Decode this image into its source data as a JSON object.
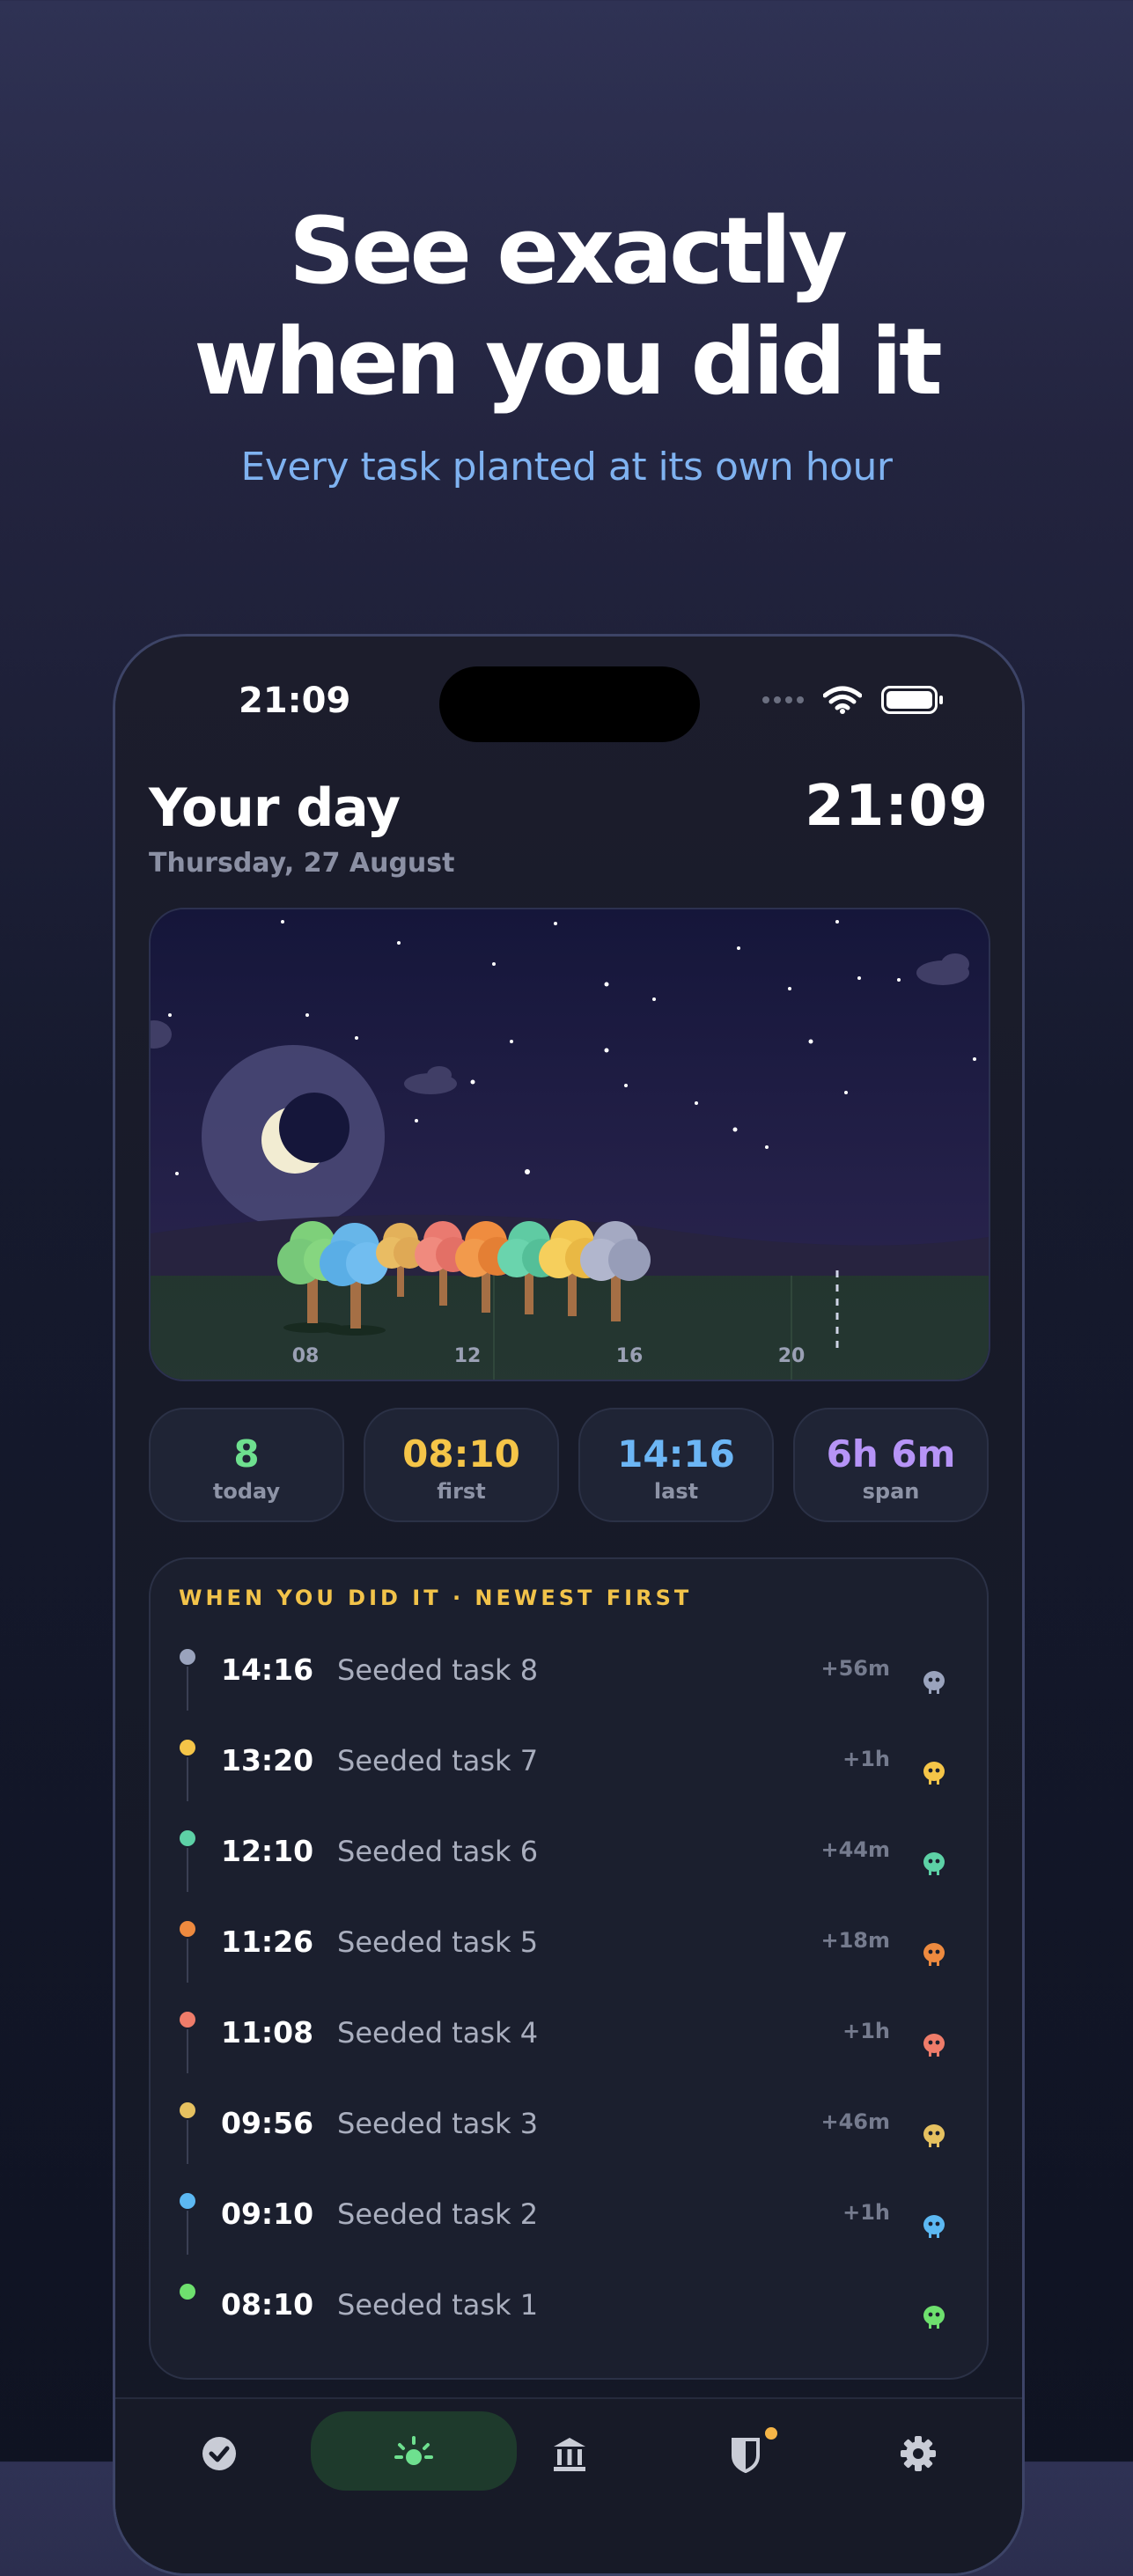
{
  "hero": {
    "line1": "See exactly",
    "line2": "when you did it",
    "subtitle": "Every task planted at its own hour"
  },
  "status_bar": {
    "time": "21:09"
  },
  "header": {
    "title": "Your day",
    "date": "Thursday, 27 August",
    "clock": "21:09"
  },
  "scene": {
    "axis_labels": [
      "08",
      "12",
      "16",
      "20"
    ],
    "sky": "night",
    "colors": {
      "sky_top": "#16163a",
      "sky_bottom": "#2c2550",
      "grass": "#253a30"
    }
  },
  "stats": [
    {
      "value": "8",
      "label": "today",
      "color": "#6ee08f"
    },
    {
      "value": "08:10",
      "label": "first",
      "color": "#f5c548"
    },
    {
      "value": "14:16",
      "label": "last",
      "color": "#6cb6f5"
    },
    {
      "value": "6h 6m",
      "label": "span",
      "color": "#b694f7"
    }
  ],
  "list": {
    "title": "WHEN YOU DID IT · NEWEST FIRST",
    "items": [
      {
        "time": "14:16",
        "label": "Seeded task 8",
        "delta": "+56m",
        "color": "#9aa3bd",
        "icon": "cloud-creature-icon"
      },
      {
        "time": "13:20",
        "label": "Seeded task 7",
        "delta": "+1h",
        "color": "#f5c548",
        "icon": "flag-creature-icon"
      },
      {
        "time": "12:10",
        "label": "Seeded task 6",
        "delta": "+44m",
        "color": "#5dd1a6",
        "icon": "sprout-creature-icon"
      },
      {
        "time": "11:26",
        "label": "Seeded task 5",
        "delta": "+18m",
        "color": "#ee8a3f",
        "icon": "bag-creature-icon"
      },
      {
        "time": "11:08",
        "label": "Seeded task 4",
        "delta": "+1h",
        "color": "#ef7c6a",
        "icon": "check-creature-icon"
      },
      {
        "time": "09:56",
        "label": "Seeded task 3",
        "delta": "+46m",
        "color": "#e6c160",
        "icon": "book-creature-icon"
      },
      {
        "time": "09:10",
        "label": "Seeded task 2",
        "delta": "+1h",
        "color": "#5cb8f2",
        "icon": "drop-creature-icon"
      },
      {
        "time": "08:10",
        "label": "Seeded task 1",
        "delta": "",
        "color": "#6ee06e",
        "icon": "leaf-creature-icon"
      }
    ]
  },
  "tabbar": {
    "tabs": [
      "check-tab-icon",
      "sun-tab-icon",
      "museum-tab-icon",
      "shield-tab-icon",
      "settings-tab-icon"
    ],
    "active": "sun-tab-icon",
    "accent": "#6ee08f"
  }
}
